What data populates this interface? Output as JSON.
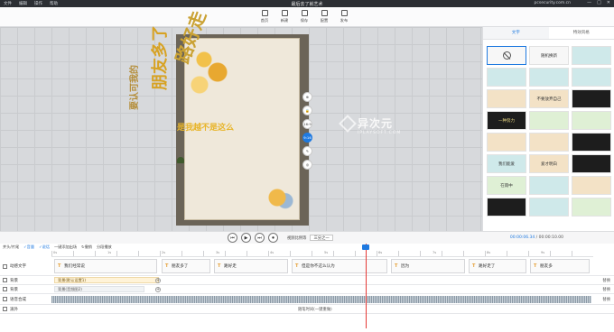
{
  "menu": [
    "文件",
    "编辑",
    "操作",
    "帮助"
  ],
  "title": "最后去了就艺术",
  "account": "pcsecurity.com.cn",
  "window_controls": [
    "—",
    "□",
    "✕"
  ],
  "toolbar": [
    {
      "label": "首页",
      "icon": "home-icon"
    },
    {
      "label": "新建",
      "icon": "new-icon"
    },
    {
      "label": "保存",
      "icon": "save-icon"
    },
    {
      "label": "配置",
      "icon": "settings-icon"
    },
    {
      "label": "发布",
      "icon": "publish-icon"
    }
  ],
  "canvas": {
    "lines": [
      "是我越不是这么",
      "朋友多了",
      "路好走",
      "路好走",
      "要认可我的"
    ],
    "watermark_main": "异次元",
    "watermark_sub": "IPLAYSOFT.COM",
    "controls": [
      "⊕",
      "🔒",
      "16:9",
      "9:16",
      "✎",
      "◎"
    ]
  },
  "right_panel": {
    "tabs": [
      "文字",
      "特效风格"
    ],
    "styles": [
      "",
      "随机换新",
      "",
      "",
      "",
      "",
      "",
      "不要放弃自己",
      "",
      "一种努力",
      "",
      "",
      "",
      "",
      "",
      "我们能爱",
      "爱才明白",
      "",
      "在雨中",
      "",
      "",
      "",
      "",
      ""
    ]
  },
  "playbar": {
    "controls": [
      "⏮",
      "▶",
      "⏭",
      "⏺"
    ],
    "ratio_label": "视频比例等",
    "ratio_value": "三分之一",
    "timecode_current": "00:00:06.34",
    "timecode_total": "00:00:10.00"
  },
  "timeline": {
    "toolbar": [
      "并头/片尾",
      "✓音量",
      "✓说话",
      "一键添加出场",
      "↻撤销",
      "分段播放"
    ],
    "ruler": [
      "0s",
      "1s",
      "2s",
      "3s",
      "4s",
      "5s",
      "6s",
      "7s",
      "8s",
      "9s"
    ],
    "tracks": [
      {
        "label": "动感文字",
        "right": ""
      },
      {
        "label": "背景",
        "right": "替换"
      },
      {
        "label": "背景",
        "right": "替换"
      },
      {
        "label": "语音合成",
        "right": "替换"
      },
      {
        "label": "滚外",
        "right": ""
      }
    ],
    "text_clips": [
      "我们经常说",
      "朋友多了",
      "路好走",
      "但是你不这么认为",
      "因为",
      "路好走了",
      "朋友多"
    ],
    "bg_clip": "背景(默认设置1)",
    "bg2_clip": "背景(音频图2)",
    "footer": "随笔时间(一键重做)"
  }
}
